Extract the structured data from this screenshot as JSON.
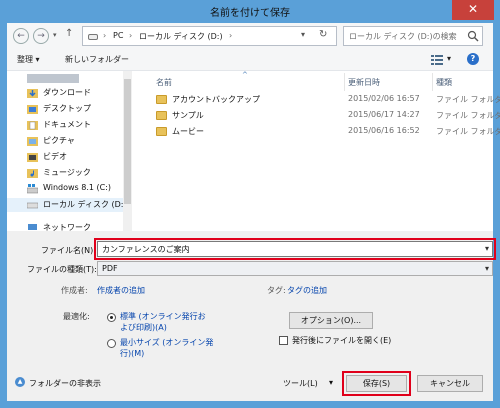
{
  "window": {
    "title": "名前を付けて保存",
    "close_glyph": "✕"
  },
  "address": {
    "crumbs": [
      "PC",
      "ローカル ディスク (D:)"
    ],
    "search_placeholder": "ローカル ディスク (D:)の検索"
  },
  "toolbar": {
    "organize_label": "整理 ▾",
    "new_folder_label": "新しいフォルダー"
  },
  "nav": {
    "items": [
      {
        "label": "ダウンロード",
        "icon": "download-folder-icon"
      },
      {
        "label": "デスクトップ",
        "icon": "desktop-folder-icon"
      },
      {
        "label": "ドキュメント",
        "icon": "documents-folder-icon"
      },
      {
        "label": "ピクチャ",
        "icon": "pictures-folder-icon"
      },
      {
        "label": "ビデオ",
        "icon": "videos-folder-icon"
      },
      {
        "label": "ミュージック",
        "icon": "music-folder-icon"
      },
      {
        "label": "Windows 8.1 (C:)",
        "icon": "windows-drive-icon"
      },
      {
        "label": "ローカル ディスク (D:)",
        "icon": "drive-icon"
      },
      {
        "label": "ネットワーク",
        "icon": "network-icon"
      }
    ]
  },
  "files": {
    "columns": {
      "name": "名前",
      "date": "更新日時",
      "type": "種類"
    },
    "rows": [
      {
        "name": "アカウントバックアップ",
        "date": "2015/02/06 16:57",
        "type": "ファイル フォルダー"
      },
      {
        "name": "サンプル",
        "date": "2015/06/17 14:27",
        "type": "ファイル フォルダー"
      },
      {
        "name": "ムービー",
        "date": "2015/06/16 16:52",
        "type": "ファイル フォルダー"
      }
    ]
  },
  "form": {
    "filename_label": "ファイル名(N):",
    "filename_value": "カンファレンスのご案内",
    "filetype_label": "ファイルの種類(T):",
    "filetype_value": "PDF",
    "author_label": "作成者:",
    "author_link": "作成者の追加",
    "tags_label": "タグ:",
    "tags_link": "タグの追加",
    "optimize_label": "最適化:",
    "opt_standard_line1": "標準 (オンライン発行お",
    "opt_standard_line2": "よび印刷)(A)",
    "opt_min_line1": "最小サイズ (オンライン発",
    "opt_min_line2": "行)(M)",
    "options_button": "オプション(O)...",
    "open_after_label": "発行後にファイルを開く(E)",
    "hide_folders_label": "フォルダーの非表示",
    "tools_label": "ツール(L)",
    "save_button": "保存(S)",
    "cancel_button": "キャンセル"
  }
}
